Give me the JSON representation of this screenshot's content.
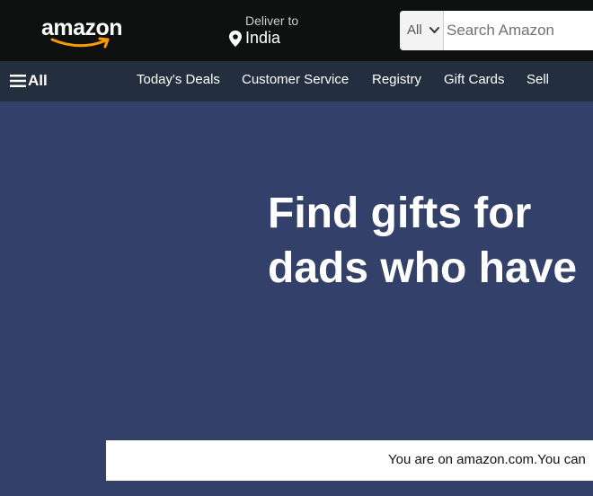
{
  "header": {
    "logo_text": "amazon",
    "deliver_label": "Deliver to",
    "deliver_location": "India",
    "search_dept": "All",
    "search_placeholder": "Search Amazon"
  },
  "nav": {
    "all_label": "All",
    "links": [
      "Today's Deals",
      "Customer Service",
      "Registry",
      "Gift Cards",
      "Sell"
    ]
  },
  "hero": {
    "title_line1": "Find gifts for",
    "title_line2": "dads who have"
  },
  "notice": {
    "text": "You are on amazon.com.You can"
  },
  "colors": {
    "topbar": "#0f1111",
    "navbar": "#232f3e",
    "hero_bg": "#33406a",
    "smile": "#ff9900"
  }
}
